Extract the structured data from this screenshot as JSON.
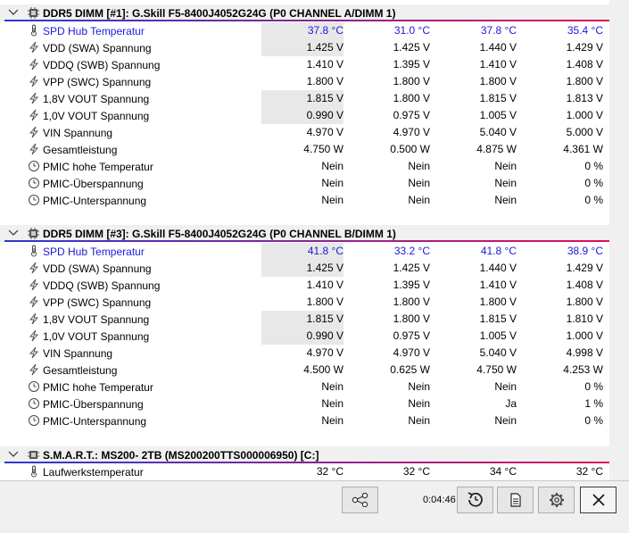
{
  "sections": [
    {
      "title": "DDR5 DIMM [#1]: G.Skill F5-8400J4052G24G (P0 CHANNEL A/DIMM 1)",
      "rows": [
        {
          "label": "SPD Hub Temperatur",
          "icon": "thermometer-icon",
          "values": [
            "37.8 °C",
            "31.0 °C",
            "37.8 °C",
            "35.4 °C"
          ]
        },
        {
          "label": "VDD (SWA) Spannung",
          "icon": "voltage-icon",
          "values": [
            "1.425 V",
            "1.425 V",
            "1.440 V",
            "1.429 V"
          ]
        },
        {
          "label": "VDDQ (SWB) Spannung",
          "icon": "voltage-icon",
          "values": [
            "1.410 V",
            "1.395 V",
            "1.410 V",
            "1.408 V"
          ]
        },
        {
          "label": "VPP (SWC) Spannung",
          "icon": "voltage-icon",
          "values": [
            "1.800 V",
            "1.800 V",
            "1.800 V",
            "1.800 V"
          ]
        },
        {
          "label": "1,8V VOUT Spannung",
          "icon": "voltage-icon",
          "values": [
            "1.815 V",
            "1.800 V",
            "1.815 V",
            "1.813 V"
          ]
        },
        {
          "label": "1,0V VOUT Spannung",
          "icon": "voltage-icon",
          "values": [
            "0.990 V",
            "0.975 V",
            "1.005 V",
            "1.000 V"
          ]
        },
        {
          "label": "VIN Spannung",
          "icon": "voltage-icon",
          "values": [
            "4.970 V",
            "4.970 V",
            "5.040 V",
            "5.000 V"
          ]
        },
        {
          "label": "Gesamtleistung",
          "icon": "power-icon",
          "values": [
            "4.750 W",
            "0.500 W",
            "4.875 W",
            "4.361 W"
          ]
        },
        {
          "label": "PMIC hohe Temperatur",
          "icon": "clock-icon",
          "values": [
            "Nein",
            "Nein",
            "Nein",
            "0 %"
          ]
        },
        {
          "label": "PMIC-Überspannung",
          "icon": "clock-icon",
          "values": [
            "Nein",
            "Nein",
            "Nein",
            "0 %"
          ]
        },
        {
          "label": "PMIC-Unterspannung",
          "icon": "clock-icon",
          "values": [
            "Nein",
            "Nein",
            "Nein",
            "0 %"
          ]
        }
      ]
    },
    {
      "title": "DDR5 DIMM [#3]: G.Skill F5-8400J4052G24G (P0 CHANNEL B/DIMM 1)",
      "rows": [
        {
          "label": "SPD Hub Temperatur",
          "icon": "thermometer-icon",
          "values": [
            "41.8 °C",
            "33.2 °C",
            "41.8 °C",
            "38.9 °C"
          ]
        },
        {
          "label": "VDD (SWA) Spannung",
          "icon": "voltage-icon",
          "values": [
            "1.425 V",
            "1.425 V",
            "1.440 V",
            "1.429 V"
          ]
        },
        {
          "label": "VDDQ (SWB) Spannung",
          "icon": "voltage-icon",
          "values": [
            "1.410 V",
            "1.395 V",
            "1.410 V",
            "1.408 V"
          ]
        },
        {
          "label": "VPP (SWC) Spannung",
          "icon": "voltage-icon",
          "values": [
            "1.800 V",
            "1.800 V",
            "1.800 V",
            "1.800 V"
          ]
        },
        {
          "label": "1,8V VOUT Spannung",
          "icon": "voltage-icon",
          "values": [
            "1.815 V",
            "1.800 V",
            "1.815 V",
            "1.810 V"
          ]
        },
        {
          "label": "1,0V VOUT Spannung",
          "icon": "voltage-icon",
          "values": [
            "0.990 V",
            "0.975 V",
            "1.005 V",
            "1.000 V"
          ]
        },
        {
          "label": "VIN Spannung",
          "icon": "voltage-icon",
          "values": [
            "4.970 V",
            "4.970 V",
            "5.040 V",
            "4.998 V"
          ]
        },
        {
          "label": "Gesamtleistung",
          "icon": "power-icon",
          "values": [
            "4.500 W",
            "0.625 W",
            "4.750 W",
            "4.253 W"
          ]
        },
        {
          "label": "PMIC hohe Temperatur",
          "icon": "clock-icon",
          "values": [
            "Nein",
            "Nein",
            "Nein",
            "0 %"
          ]
        },
        {
          "label": "PMIC-Überspannung",
          "icon": "clock-icon",
          "values": [
            "Nein",
            "Nein",
            "Ja",
            "1 %"
          ]
        },
        {
          "label": "PMIC-Unterspannung",
          "icon": "clock-icon",
          "values": [
            "Nein",
            "Nein",
            "Nein",
            "0 %"
          ]
        }
      ]
    },
    {
      "title": "S.M.A.R.T.: MS200- 2TB (MS200200TTS000006950) [C:]",
      "rows": [
        {
          "label": "Laufwerkstemperatur",
          "icon": "thermometer-icon",
          "values": [
            "32 °C",
            "32 °C",
            "34 °C",
            "32 °C"
          ]
        }
      ]
    }
  ],
  "toolbar": {
    "timer": "0:04:46",
    "buttons": [
      "share-icon",
      "reset-clock-icon",
      "report-icon",
      "settings-icon",
      "close-icon"
    ]
  },
  "colors": {
    "highlight_text": "#1a1adb",
    "section_line_start": "#2a3ad0",
    "section_line_end": "#e0105a",
    "shaded_cell": "#e8e8e8"
  }
}
